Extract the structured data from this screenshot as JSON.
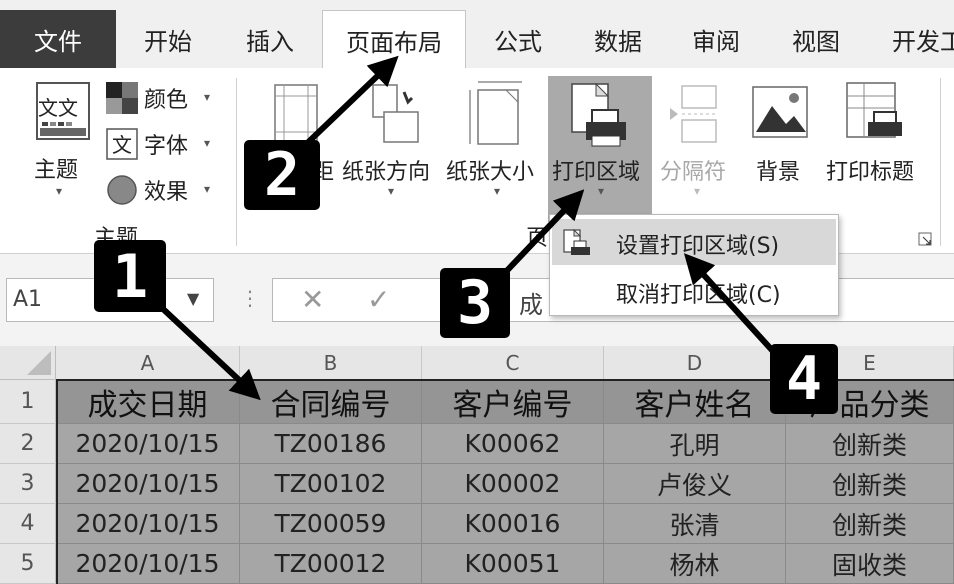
{
  "tabs": {
    "file": "文件",
    "home": "开始",
    "insert": "插入",
    "page_layout": "页面布局",
    "formulas": "公式",
    "data": "数据",
    "review": "审阅",
    "view": "视图",
    "developer": "开发工"
  },
  "ribbon": {
    "themes_label": "主题",
    "colors_label": "颜色",
    "fonts_label": "字体",
    "effects_label": "效果",
    "group_themes_label": "主题",
    "margins_label_fragment": "距",
    "orientation_label": "纸张方向",
    "size_label": "纸张大小",
    "print_area_label": "打印区域",
    "breaks_label": "分隔符",
    "background_label": "背景",
    "print_titles_label": "打印标题",
    "group_page_setup_fragment": "页",
    "theme_icon_text": "文文"
  },
  "menu": {
    "set_print_area": "设置打印区域(S)",
    "clear_print_area": "取消打印区域(C)"
  },
  "formula_bar": {
    "name_box": "A1",
    "content_fragment": "成"
  },
  "grid": {
    "columns": [
      "A",
      "B",
      "C",
      "D",
      "E"
    ],
    "row_numbers": [
      "1",
      "2",
      "3",
      "4",
      "5"
    ],
    "headers": [
      "成交日期",
      "合同编号",
      "客户编号",
      "客户姓名",
      "产品分类"
    ],
    "rows": [
      [
        "2020/10/15",
        "TZ00186",
        "K00062",
        "孔明",
        "创新类"
      ],
      [
        "2020/10/15",
        "TZ00102",
        "K00002",
        "卢俊义",
        "创新类"
      ],
      [
        "2020/10/15",
        "TZ00059",
        "K00016",
        "张清",
        "创新类"
      ],
      [
        "2020/10/15",
        "TZ00012",
        "K00051",
        "杨林",
        "固收类"
      ]
    ]
  },
  "callouts": [
    "1",
    "2",
    "3",
    "4"
  ],
  "colors": {
    "file_tab": "#3c3c3c",
    "selection_header": "#959595",
    "selection_cells": "#a6a6a6",
    "highlight_button": "#aaaaaa",
    "callout": "#000000"
  }
}
